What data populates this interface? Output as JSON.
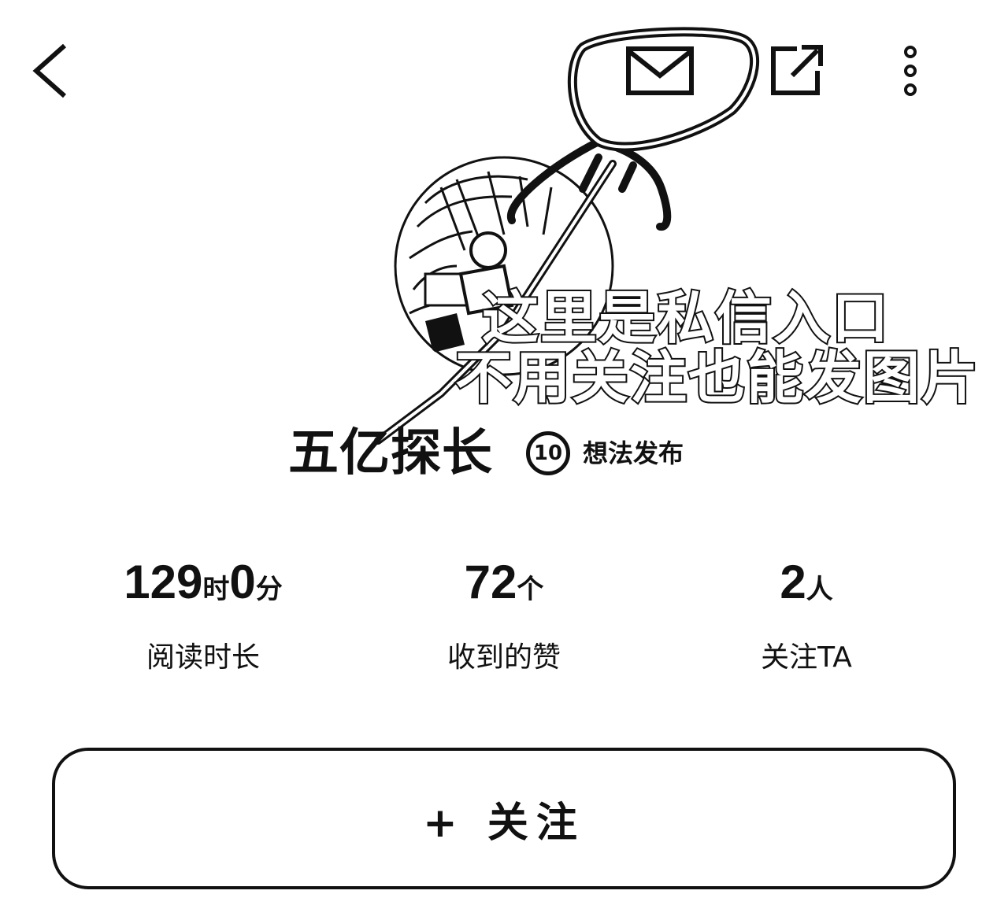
{
  "header": {
    "back_icon": "chevron-left-icon",
    "message_icon": "mail-icon",
    "share_icon": "share-external-icon",
    "more_icon": "more-vertical-icon"
  },
  "annotation": {
    "line1": "这里是私信入口",
    "line2": "不用关注也能发图片"
  },
  "profile": {
    "name": "五亿探长",
    "level": "10",
    "badge_text": "想法发布"
  },
  "stats": [
    {
      "value": "129",
      "unit1": "时",
      "value2": "0",
      "unit2": "分",
      "label": "阅读时长"
    },
    {
      "value": "72",
      "unit1": "个",
      "label": "收到的赞"
    },
    {
      "value": "2",
      "unit1": "人",
      "label": "关注TA"
    }
  ],
  "follow_button": {
    "label": "+ 关注"
  }
}
